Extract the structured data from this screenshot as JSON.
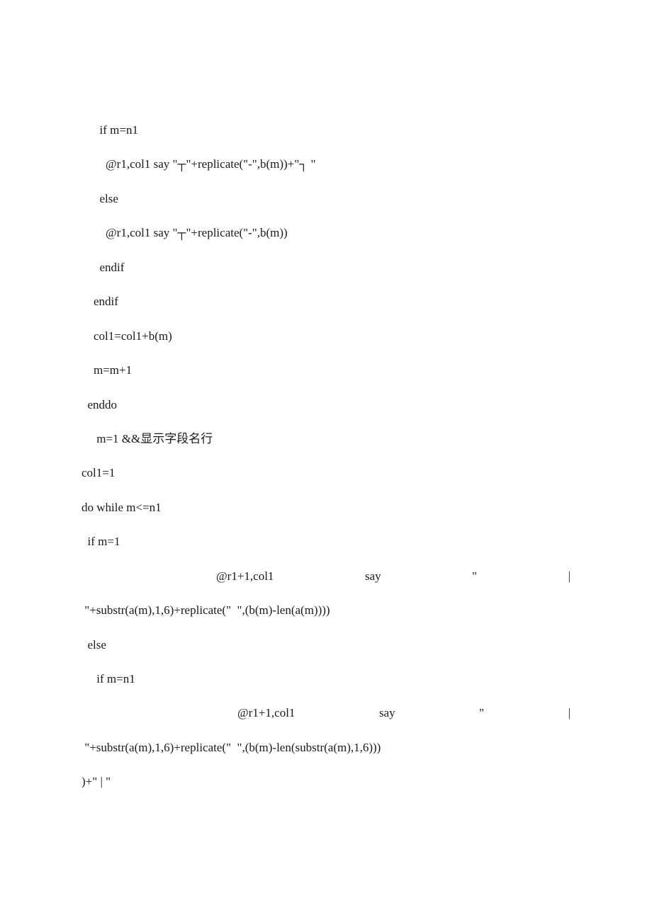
{
  "lines": {
    "l1": "      if m=n1",
    "l2": "        @r1,col1 say \"┬\"+replicate(\"-\",b(m))+\"┐ \"",
    "l3": "      else",
    "l4": "        @r1,col1 say \"┬\"+replicate(\"-\",b(m))",
    "l5": "      endif",
    "l6": "    endif",
    "l7": "    col1=col1+b(m)",
    "l8": "    m=m+1",
    "l9": "  enddo",
    "l10": "     m=1 &&显示字段名行",
    "l11": "col1=1",
    "l12": "do while m<=n1",
    "l13": "  if m=1",
    "l14a": "@r1+1,col1",
    "l14b": "say",
    "l14c": "\"",
    "l14d": "|",
    "l15": " \"+substr(a(m),1,6)+replicate(\"  \",(b(m)-len(a(m))))",
    "l16": "  else",
    "l17": "     if m=n1",
    "l18a": "@r1+1,col1",
    "l18b": "say",
    "l18c": "\"",
    "l18d": "|",
    "l19": " \"+substr(a(m),1,6)+replicate(\"  \",(b(m)-len(substr(a(m),1,6)))",
    "l20": ")+\" | \""
  }
}
